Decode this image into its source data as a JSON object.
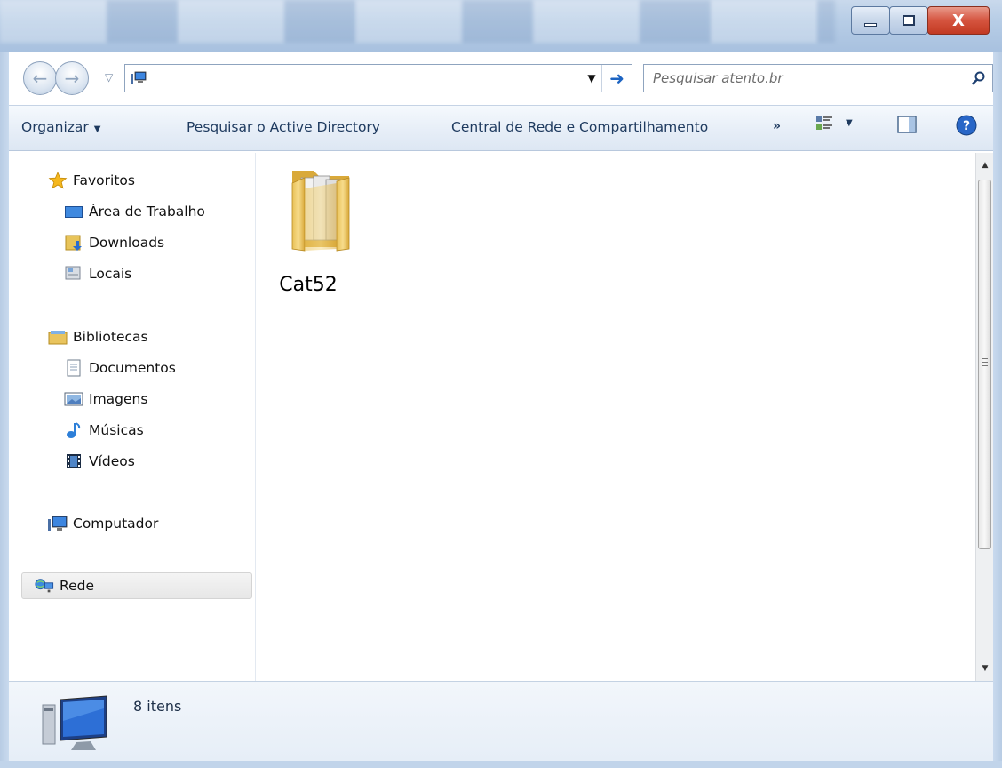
{
  "window": {
    "minimize": "—",
    "maximize": "□",
    "close": "X"
  },
  "address_bar": {
    "path": "",
    "search_placeholder": "Pesquisar atento.br"
  },
  "toolbar": {
    "organize": "Organizar",
    "search_ad": "Pesquisar o Active Directory",
    "network_center": "Central de Rede e Compartilhamento",
    "more": "»"
  },
  "nav": {
    "favorites_header": "Favoritos",
    "favorites": [
      {
        "label": "Área de Trabalho",
        "icon": "desktop-icon"
      },
      {
        "label": "Downloads",
        "icon": "downloads-icon"
      },
      {
        "label": "Locais",
        "icon": "recent-places-icon"
      }
    ],
    "libraries_header": "Bibliotecas",
    "libraries": [
      {
        "label": "Documentos",
        "icon": "documents-icon"
      },
      {
        "label": "Imagens",
        "icon": "pictures-icon"
      },
      {
        "label": "Músicas",
        "icon": "music-icon"
      },
      {
        "label": "Vídeos",
        "icon": "videos-icon"
      }
    ],
    "computer": "Computador",
    "network": "Rede",
    "selected": "Rede"
  },
  "content": {
    "items": [
      {
        "name": "Cat52",
        "icon": "folder-icon"
      }
    ]
  },
  "details": {
    "item_count": "8 itens"
  },
  "colors": {
    "accent": "#1d64c2",
    "command_text": "#1e3a5f",
    "close_red": "#c23a22"
  }
}
